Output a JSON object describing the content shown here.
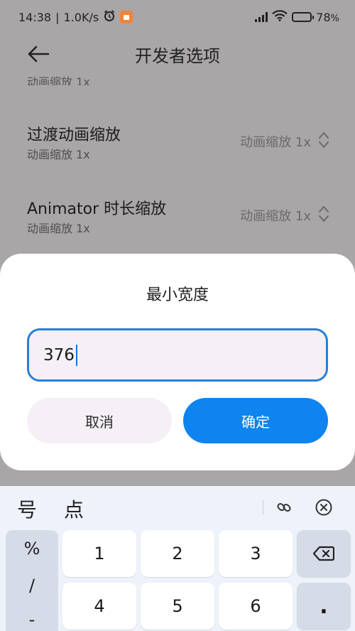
{
  "status_bar": {
    "time": "14:38",
    "speed": "1.0K/s",
    "battery": "78",
    "battery_level": 0.78
  },
  "header": {
    "title": "开发者选项"
  },
  "settings": {
    "cut_subtitle": "动画缩放 1x",
    "rows": [
      {
        "title": "过渡动画缩放",
        "subtitle": "动画缩放 1x",
        "value": "动画缩放 1x"
      },
      {
        "title": "Animator 时长缩放",
        "subtitle": "动画缩放 1x",
        "value": "动画缩放 1x"
      }
    ]
  },
  "dialog": {
    "title": "最小宽度",
    "input_value": "376",
    "cancel_label": "取消",
    "confirm_label": "确定"
  },
  "keyboard": {
    "suggestions": [
      "号",
      "点"
    ],
    "side_keys": [
      "%",
      "/",
      "-"
    ],
    "keys_row1": [
      "1",
      "2",
      "3"
    ],
    "keys_row2": [
      "4",
      "5",
      "6"
    ],
    "dot_key": "."
  },
  "colors": {
    "accent": "#0d84f0",
    "input_border": "#2a7fd4",
    "scrim": "#a9a6a8",
    "record_badge": "#f0833a"
  },
  "icons": {
    "back": "arrow-left-icon",
    "alarm": "alarm-icon",
    "record": "screen-record-icon",
    "signal": "signal-icon",
    "wifi": "wifi-icon",
    "battery": "battery-icon",
    "updown": "chevron-updown-icon",
    "clipboard": "clipboard-link-icon",
    "close": "close-circle-icon",
    "backspace": "backspace-icon"
  }
}
